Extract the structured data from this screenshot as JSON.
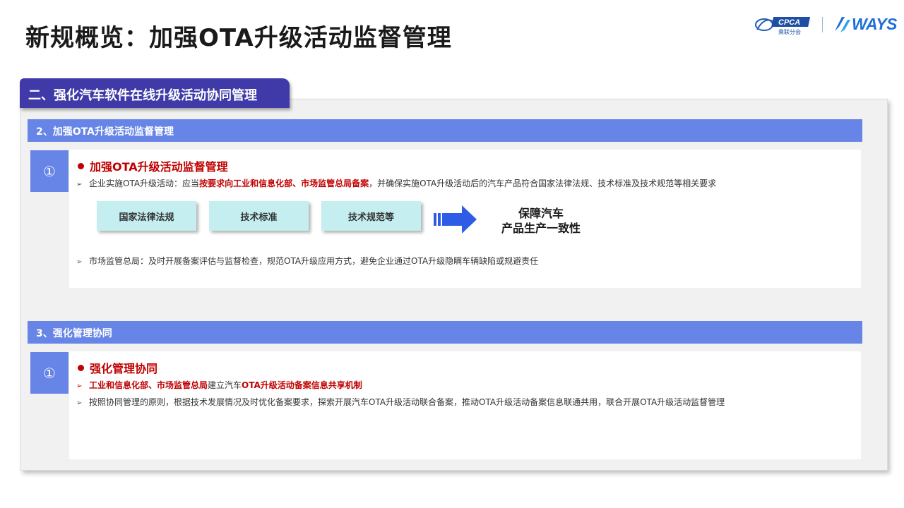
{
  "page": {
    "title": "新规概览：加强OTA升级活动监督管理"
  },
  "logos": {
    "cpca_text": "CPCA",
    "cpca_sub": "乘联分会",
    "ways_text": "WAYS"
  },
  "section_tab": "二、强化汽车软件在线升级活动协同管理",
  "block1": {
    "header": "2、加强OTA升级活动监督管理",
    "number": "①",
    "title": "加强OTA升级活动监督管理",
    "line1": {
      "prefix": "企业实施OTA升级活动：应当",
      "emphasis": "按要求向工业和信息化部、市场监管总局备案",
      "suffix": "，并确保实施OTA升级活动后的汽车产品符合国家法律法规、技术标准及技术规范等相关要求"
    },
    "boxes": [
      "国家法律法规",
      "技术标准",
      "技术规范等"
    ],
    "result_line1": "保障汽车",
    "result_line2": "产品生产一致性",
    "line2": "市场监管总局：及时开展备案评估与监督检查，规范OTA升级应用方式，避免企业通过OTA升级隐瞒车辆缺陷或规避责任"
  },
  "block2": {
    "header": "3、强化管理协同",
    "number": "①",
    "title": "强化管理协同",
    "line1": {
      "emphasis": "工业和信息化部、市场监管总局",
      "middle": "建立汽车",
      "emphasis2": "OTA升级活动备案信息共享机制"
    },
    "line2": "按照协同管理的原则，根据技术发展情况及时优化备案要求，探索开展汽车OTA升级活动联合备案，推动OTA升级活动备案信息联通共用，联合开展OTA升级活动监督管理"
  },
  "colors": {
    "tab": "#3f3aa8",
    "header": "#6685e6",
    "emphasis": "#c00000",
    "box": "#c5eef0",
    "arrow": "#2e5ce6"
  }
}
